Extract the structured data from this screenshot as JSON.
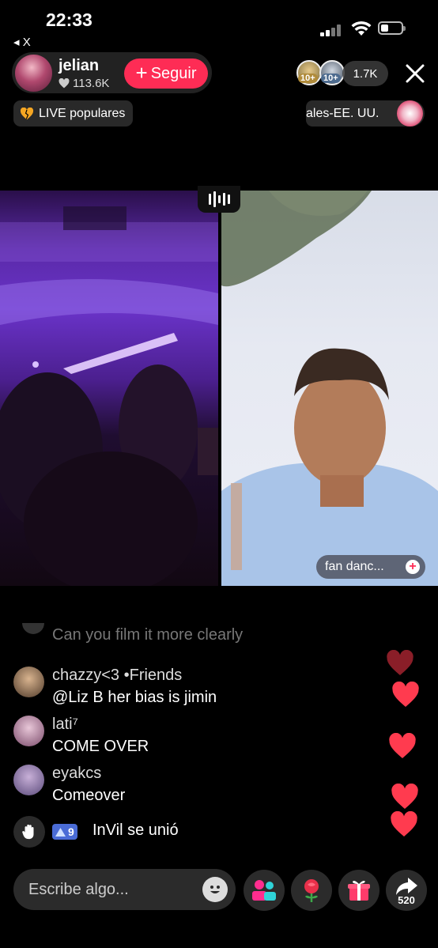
{
  "status_bar": {
    "time": "22:33",
    "back_app": "◂ X"
  },
  "host": {
    "name": "jelian",
    "likes": "113.6K",
    "follow_label": "Seguir"
  },
  "viewers": {
    "badge1": "10+",
    "badge2": "10+",
    "count": "1.7K"
  },
  "tags": {
    "popular": "LIVE populares",
    "region": "ales-EE. UU."
  },
  "video": {
    "guest_label": "fan danc..."
  },
  "comments": {
    "faded": "Can you film it more clearly",
    "items": [
      {
        "user": "chazzy<3 •Friends",
        "text": "@Liz B her bias is jimin"
      },
      {
        "user": "lati⁷",
        "text": "COME OVER"
      },
      {
        "user": "eyakcs",
        "text": "Comeover"
      }
    ],
    "joined": {
      "level": "9",
      "text": "InVil se unió"
    }
  },
  "bottom_bar": {
    "placeholder": "Escribe algo...",
    "share_count": "520"
  },
  "colors": {
    "accent": "#fe2c55",
    "heart": "#ff3b4f",
    "level_badge": "#4a6cd6"
  }
}
